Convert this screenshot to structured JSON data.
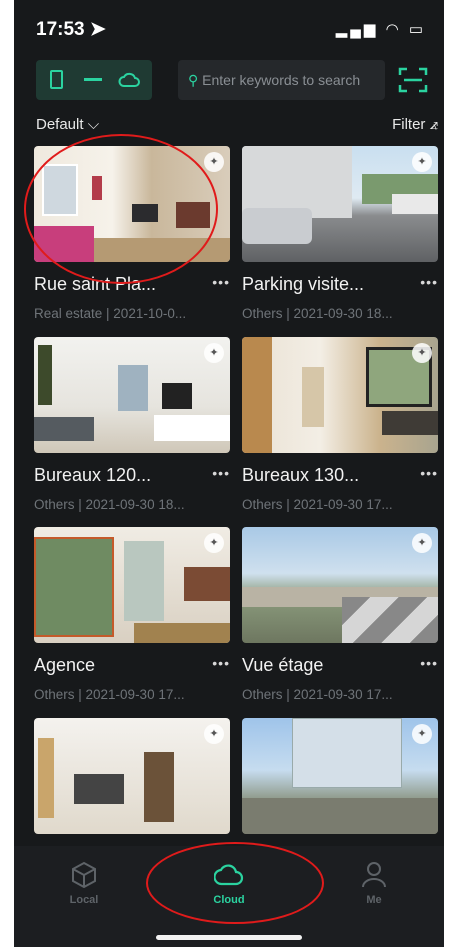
{
  "status_bar": {
    "time": "17:53 ➤",
    "icons": "▂▄▆ ◠ ▭"
  },
  "search": {
    "placeholder": "Enter keywords to search"
  },
  "toolbar": {
    "sort_label": "Default ⌵",
    "filter_label": "Filter ⦨"
  },
  "colors": {
    "accent": "#2bd3a0",
    "background": "#17191b",
    "annotation": "#e01b1b"
  },
  "projects": [
    {
      "title": "Rue saint Pla...",
      "meta": "Real estate | 2021-10-0...",
      "more": "•••"
    },
    {
      "title": "Parking visite...",
      "meta": "Others | 2021-09-30 18...",
      "more": "•••"
    },
    {
      "title": "Bureaux 120...",
      "meta": "Others | 2021-09-30 18...",
      "more": "•••"
    },
    {
      "title": "Bureaux 130...",
      "meta": "Others | 2021-09-30 17...",
      "more": "•••"
    },
    {
      "title": "Agence",
      "meta": "Others | 2021-09-30 17...",
      "more": "•••"
    },
    {
      "title": "Vue étage",
      "meta": "Others | 2021-09-30 17...",
      "more": "•••"
    },
    {
      "title": "",
      "meta": "",
      "more": ""
    },
    {
      "title": "",
      "meta": "",
      "more": ""
    }
  ],
  "tabs": [
    {
      "label": "Local",
      "icon": "box-icon",
      "active": false
    },
    {
      "label": "Cloud",
      "icon": "cloud-icon",
      "active": true
    },
    {
      "label": "Me",
      "icon": "user-icon",
      "active": false
    }
  ]
}
